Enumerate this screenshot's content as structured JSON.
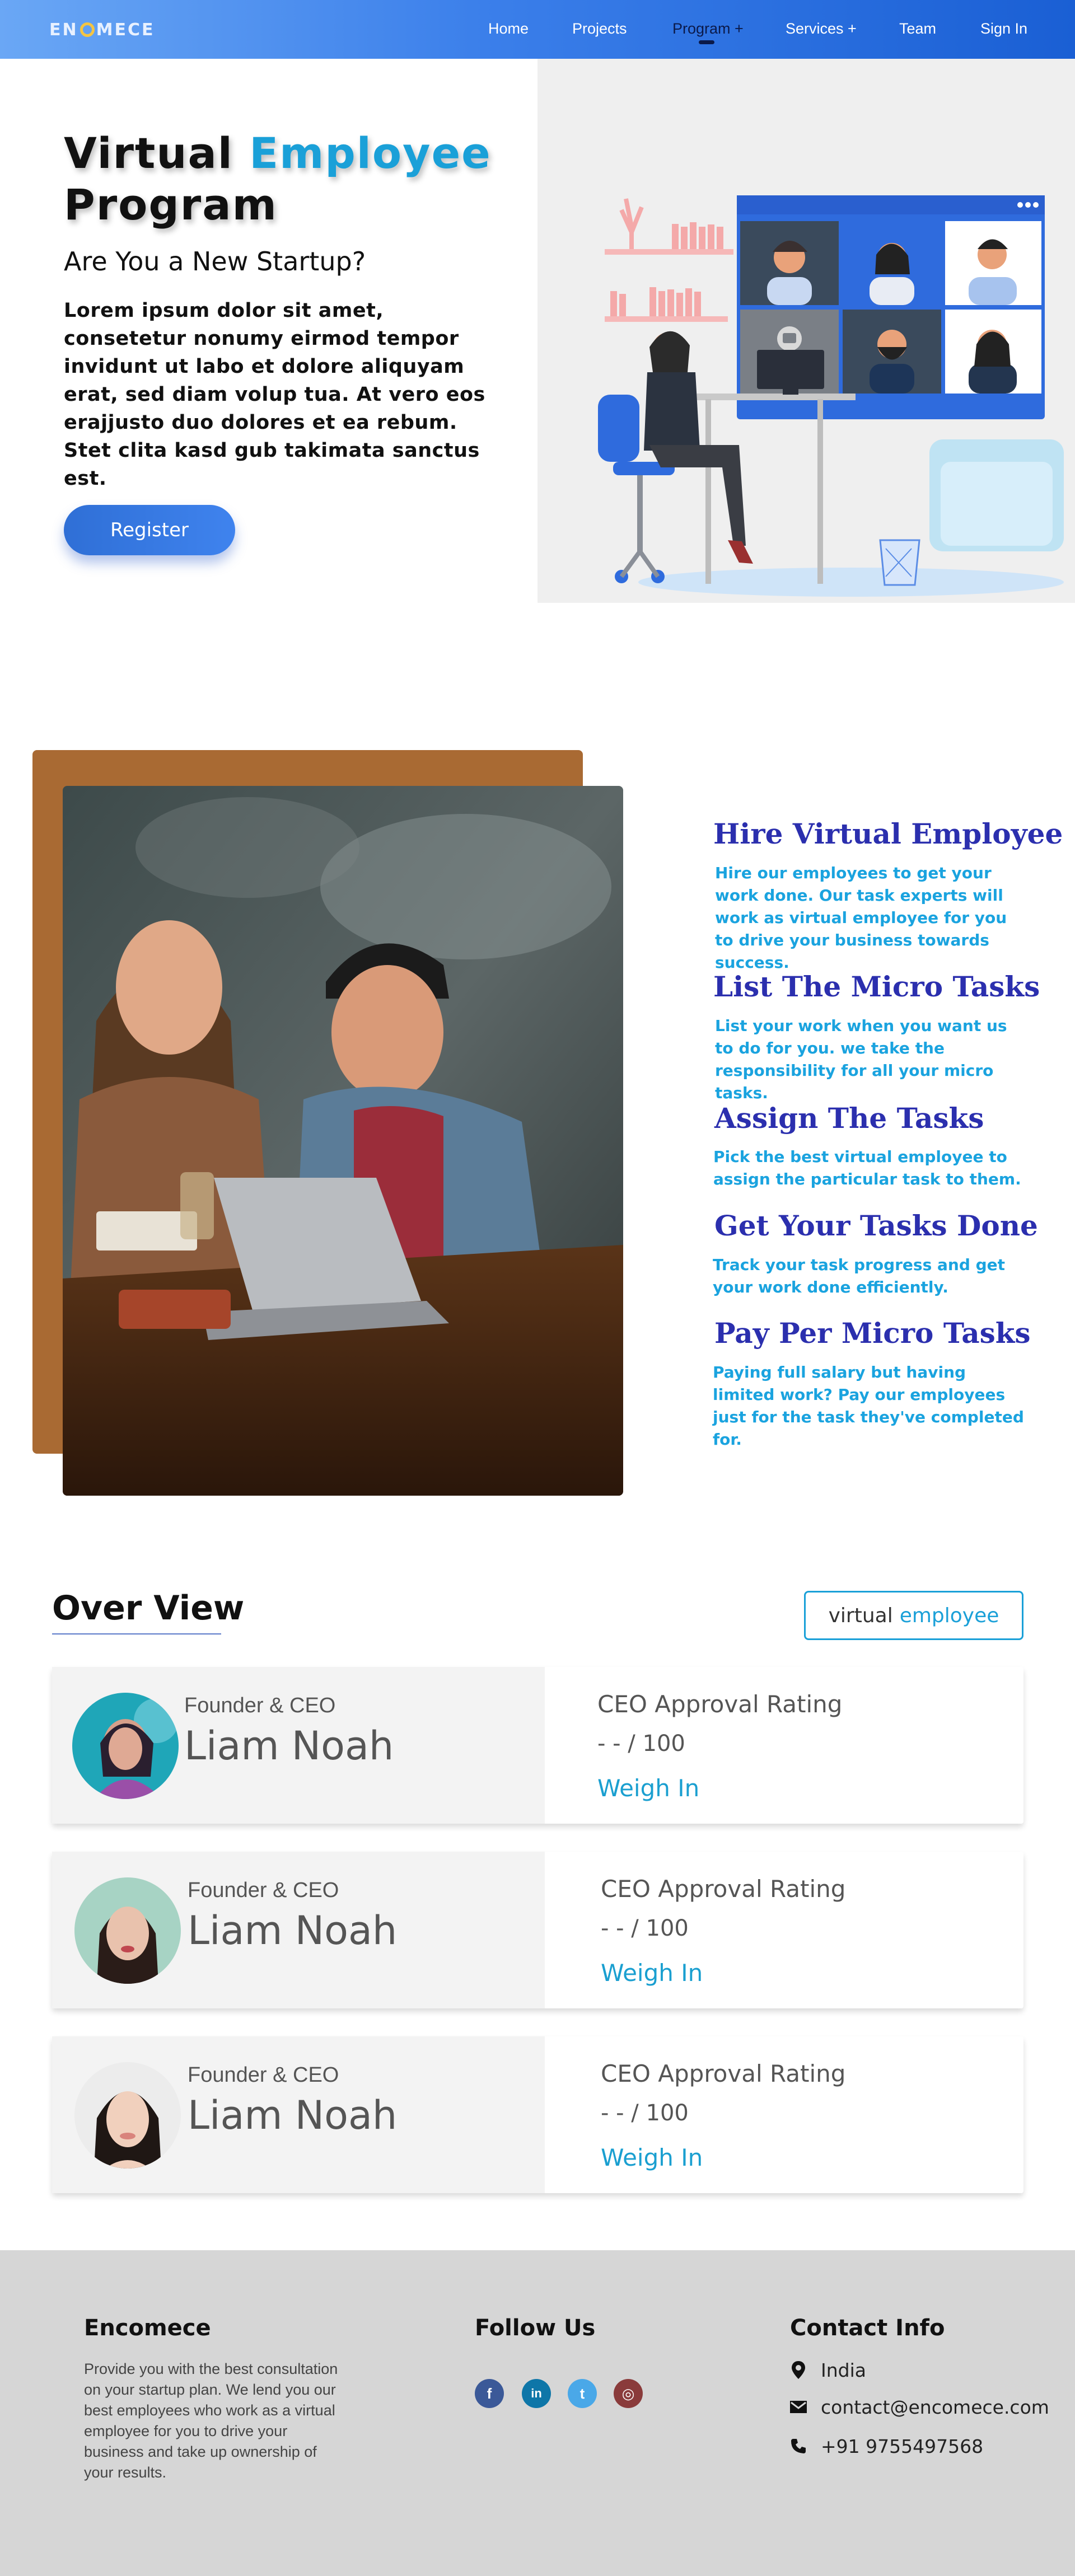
{
  "brand": {
    "logo_text_pre": "EN",
    "logo_text_post": "MECE"
  },
  "nav": {
    "items": [
      {
        "label": "Home"
      },
      {
        "label": "Projects"
      },
      {
        "label": "Program +"
      },
      {
        "label": "Services +"
      },
      {
        "label": "Team"
      },
      {
        "label": "Sign In"
      }
    ],
    "active": "Program +"
  },
  "hero": {
    "title_part1": "Virtual",
    "title_accent": "Employee",
    "title_part2": "Program",
    "subtitle": "Are You a New Startup?",
    "body": "Lorem ipsum dolor sit amet, consetetur nonumy eirmod tempor invidunt ut labo et dolore aliquyam erat, sed diam volup tua. At vero eos erajjusto duo dolores et ea rebum. Stet clita kasd gub takimata sanctus est.",
    "register_label": "Register"
  },
  "features": [
    {
      "title": "Hire Virtual Employee",
      "desc": "Hire our employees to get your work done. Our task experts will work as virtual employee for you to drive your business towards success."
    },
    {
      "title": "List The Micro Tasks",
      "desc": "List your work when you want us to do for you. we take the responsibility for all your micro tasks."
    },
    {
      "title": "Assign The Tasks",
      "desc": "Pick the best virtual employee to assign the particular task to them."
    },
    {
      "title": "Get Your Tasks Done",
      "desc": "Track your task progress and get your work done efficiently."
    },
    {
      "title": "Pay Per Micro Tasks",
      "desc": "Paying full salary but having limited work? Pay our employees just for the task they've completed for."
    }
  ],
  "overview": {
    "title": "Over View",
    "badge_pre": "virtual",
    "badge_highlight": "employee",
    "cards": [
      {
        "role": "Founder & CEO",
        "name": "Liam Noah",
        "rating_label": "CEO Approval Rating",
        "score": "- - / 100",
        "action": "Weigh In"
      },
      {
        "role": "Founder & CEO",
        "name": "Liam Noah",
        "rating_label": "CEO Approval Rating",
        "score": "- - / 100",
        "action": "Weigh In"
      },
      {
        "role": "Founder & CEO",
        "name": "Liam Noah",
        "rating_label": "CEO Approval Rating",
        "score": "- - / 100",
        "action": "Weigh In"
      }
    ]
  },
  "footer": {
    "brand_title": "Encomece",
    "about": "Provide you with the best consultation on your startup plan. We lend you our best employees who work as a virtual employee for you to drive your business and take up ownership of your results.",
    "follow_title": "Follow Us",
    "social": [
      {
        "icon": "facebook-icon",
        "color": "#3b5998",
        "glyph": "f"
      },
      {
        "icon": "linkedin-icon",
        "color": "#0e76a8",
        "glyph": "in"
      },
      {
        "icon": "twitter-icon",
        "color": "#4aa8e8",
        "glyph": "t"
      },
      {
        "icon": "instagram-icon",
        "color": "#8a3b3b",
        "glyph": "◎"
      }
    ],
    "contact_title": "Contact Info",
    "location": "India",
    "email": "contact@encomece.com",
    "phone": "+91 9755497568"
  },
  "colors": {
    "nav_start": "#6aa7f5",
    "nav_end": "#1a5fd4",
    "accent": "#1aa0d8",
    "feature_title": "#2b2fae",
    "footer_bg": "#d6d6d6"
  }
}
